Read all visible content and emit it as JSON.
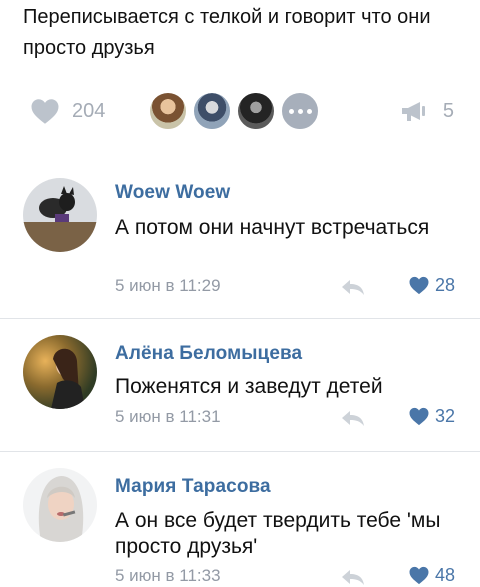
{
  "post": {
    "text": "Переписывается с телкой и говорит что они просто друзья"
  },
  "stats": {
    "likes_count": "204",
    "shares_count": "5",
    "like_icon": "heart-icon",
    "share_icon": "megaphone-icon"
  },
  "comments": [
    {
      "author": "Woew Woew",
      "text": "А потом они начнут встречаться",
      "date": "5 июн в 11:29",
      "likes": "28"
    },
    {
      "author": "Алёна Беломыцева",
      "text": "Поженятся и заведут детей",
      "date": "5 июн в 11:31",
      "likes": "32"
    },
    {
      "author": "Мария Тарасова",
      "text": "А он все будет твердить тебе 'мы просто друзья'",
      "date": "5 июн в 11:33",
      "likes": "48"
    }
  ],
  "colors": {
    "name": "#3d6da0",
    "like_active": "#4a76a8",
    "muted": "#a5acb6"
  }
}
